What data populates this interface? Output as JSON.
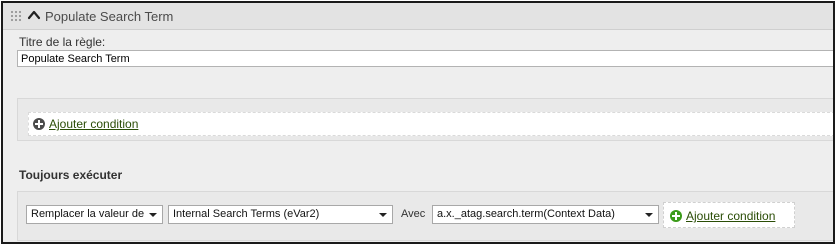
{
  "rule_header": {
    "title": "Populate Search Term"
  },
  "rule_title": {
    "label": "Titre de la règle:",
    "value": "Populate Search Term"
  },
  "conditions": {
    "add_label": "Ajouter condition"
  },
  "always_execute": {
    "heading": "Toujours exécuter",
    "action_select": "Remplacer la valeur de",
    "variable_select": "Internal Search Terms (eVar2)",
    "with_label": "Avec",
    "value_select": "a.x._atag.search.term(Context Data)",
    "add_label": "Ajouter condition"
  },
  "colors": {
    "link": "#2a4d06",
    "plus_dark": "#4b4b4b",
    "plus_green": "#3b9b1a"
  }
}
